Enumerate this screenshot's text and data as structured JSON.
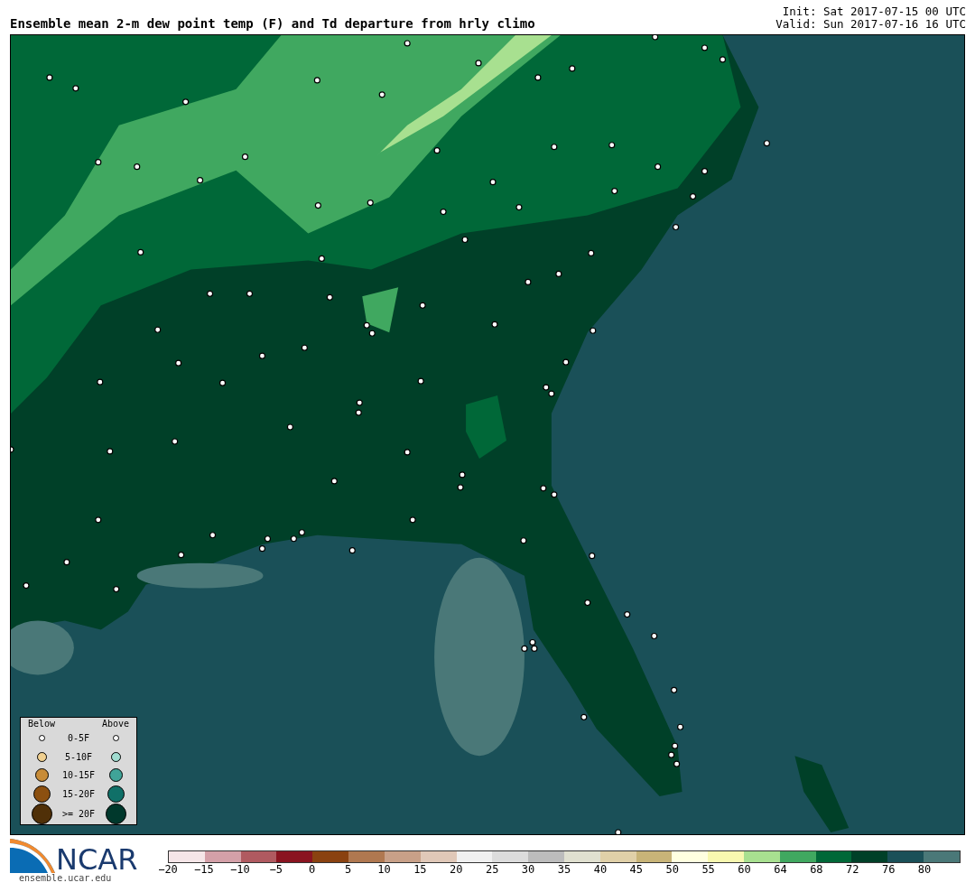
{
  "title": "Ensemble mean 2-m dew point temp (F) and Td departure from hrly climo",
  "init": "Init: Sat 2017-07-15 00 UTC",
  "valid": "Valid: Sun 2017-07-16 16 UTC",
  "legend": {
    "below_label": "Below",
    "above_label": "Above",
    "rows": [
      {
        "label": "0-5F",
        "below": {
          "color": "#ffffff"
        },
        "above": {
          "color": "#ffffff"
        }
      },
      {
        "label": "5-10F",
        "below": {
          "color": "#f0d090"
        },
        "above": {
          "color": "#a0dcd0"
        }
      },
      {
        "label": "10-15F",
        "below": {
          "color": "#c88c38"
        },
        "above": {
          "color": "#40a498"
        }
      },
      {
        "label": "15-20F",
        "below": {
          "color": "#8c5010"
        },
        "above": {
          "color": "#107068"
        }
      },
      {
        "label": ">= 20F",
        "below": {
          "color": "#503008"
        },
        "above": {
          "color": "#00382c"
        }
      }
    ]
  },
  "logo": {
    "wordmark": "NCAR",
    "url": "ensemble.ucar.edu"
  },
  "colorbar": {
    "segments": [
      {
        "color": "#f5e6e8"
      },
      {
        "color": "#d4a0a8"
      },
      {
        "color": "#b05a60"
      },
      {
        "color": "#8a1420"
      },
      {
        "color": "#8a4210"
      },
      {
        "color": "#b07850"
      },
      {
        "color": "#c8a088"
      },
      {
        "color": "#e0c8b8"
      },
      {
        "color": "#f0f0f0"
      },
      {
        "color": "#dcdcdc"
      },
      {
        "color": "#bcbcbc"
      },
      {
        "color": "#e0e0d0"
      },
      {
        "color": "#e0d0a8"
      },
      {
        "color": "#c8b478"
      },
      {
        "color": "#ffffe0"
      },
      {
        "color": "#f8f8b0"
      },
      {
        "color": "#a8e090"
      },
      {
        "color": "#40a860"
      },
      {
        "color": "#006838"
      },
      {
        "color": "#004028"
      },
      {
        "color": "#1a5058"
      },
      {
        "color": "#4a7878"
      }
    ],
    "ticks": [
      "−20",
      "−15",
      "−10",
      "−5",
      "0",
      "5",
      "10",
      "15",
      "20",
      "25",
      "30",
      "35",
      "40",
      "45",
      "50",
      "55",
      "60",
      "64",
      "68",
      "72",
      "76",
      "80"
    ]
  }
}
